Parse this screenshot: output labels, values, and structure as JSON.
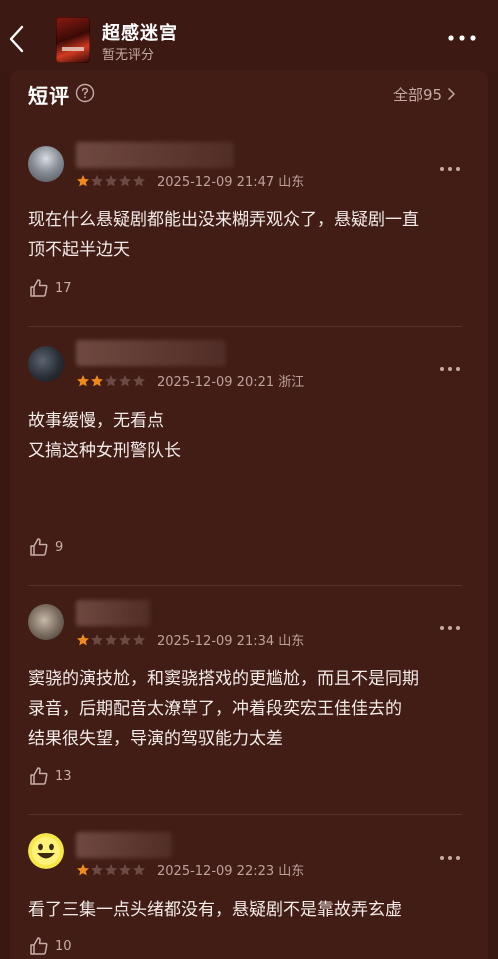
{
  "header": {
    "title": "超感迷宫",
    "subtitle": "暂无评分"
  },
  "section": {
    "title": "短评",
    "all_label": "全部95"
  },
  "reviews": [
    {
      "rating": 1,
      "date": "2025-12-09 21:47",
      "location": "山东",
      "lines": [
        "现在什么悬疑剧都能出没来糊弄观众了，悬疑剧一直",
        "顶不起半边天"
      ],
      "likes": "17"
    },
    {
      "rating": 2,
      "date": "2025-12-09 20:21",
      "location": "浙江",
      "lines": [
        "故事缓慢，无看点",
        "又搞这种女刑警队长"
      ],
      "likes": "9"
    },
    {
      "rating": 1,
      "date": "2025-12-09 21:34",
      "location": "山东",
      "lines": [
        "窦骁的演技尬，和窦骁搭戏的更尴尬，而且不是同期",
        "录音，后期配音太潦草了，冲着段奕宏王佳佳去的",
        "结果很失望，导演的驾驭能力太差"
      ],
      "likes": "13"
    },
    {
      "rating": 1,
      "date": "2025-12-09 22:23",
      "location": "山东",
      "lines": [
        "看了三集一点头绪都没有，悬疑剧不是靠故弄玄虚"
      ],
      "likes": "10"
    }
  ],
  "colors": {
    "background": "#3a1812",
    "card": "#411d16",
    "star_filled": "#f08a1c",
    "star_empty": "#6b4a43"
  },
  "icons": [
    "back-icon",
    "more-icon",
    "help-icon",
    "chevron-right-icon",
    "thumbs-up-icon",
    "star-icon"
  ]
}
